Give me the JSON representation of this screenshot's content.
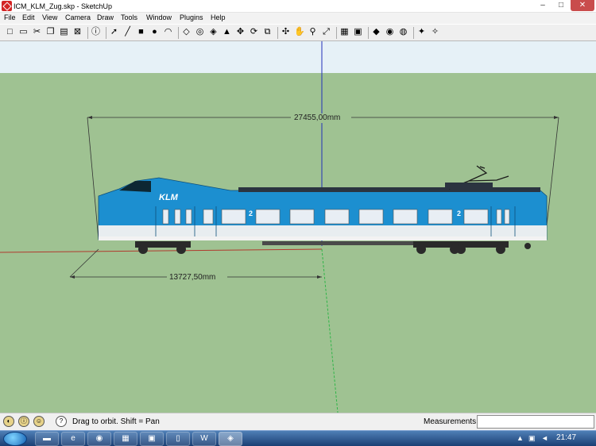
{
  "window": {
    "title": "ICM_KLM_Zug.skp - SketchUp",
    "minimize_glyph": "–",
    "maximize_glyph": "□",
    "close_glyph": "✕"
  },
  "menu": [
    "File",
    "Edit",
    "View",
    "Camera",
    "Draw",
    "Tools",
    "Window",
    "Plugins",
    "Help"
  ],
  "toolbar": {
    "tools": [
      {
        "name": "new-icon",
        "glyph": "□"
      },
      {
        "name": "open-icon",
        "glyph": "▭"
      },
      {
        "name": "cut-icon",
        "glyph": "✂"
      },
      {
        "name": "copy-icon",
        "glyph": "❐"
      },
      {
        "name": "paste-icon",
        "glyph": "▤"
      },
      {
        "name": "erase-icon",
        "glyph": "⊠"
      },
      {
        "name": "model-info-icon",
        "glyph": "ⓘ"
      },
      {
        "name": "select-icon",
        "glyph": "➚"
      },
      {
        "name": "line-icon",
        "glyph": "╱"
      },
      {
        "name": "rectangle-icon",
        "glyph": "■"
      },
      {
        "name": "circle-icon",
        "glyph": "●"
      },
      {
        "name": "arc-icon",
        "glyph": "◠"
      },
      {
        "name": "eraser-icon",
        "glyph": "◇"
      },
      {
        "name": "tape-measure-icon",
        "glyph": "◎"
      },
      {
        "name": "paint-bucket-icon",
        "glyph": "◈"
      },
      {
        "name": "push-pull-icon",
        "glyph": "▲"
      },
      {
        "name": "move-icon",
        "glyph": "✥"
      },
      {
        "name": "rotate-icon",
        "glyph": "⟳"
      },
      {
        "name": "offset-icon",
        "glyph": "⧉"
      },
      {
        "name": "orbit-icon",
        "glyph": "✣"
      },
      {
        "name": "pan-icon",
        "glyph": "✋"
      },
      {
        "name": "zoom-icon",
        "glyph": "⚲"
      },
      {
        "name": "zoom-extents-icon",
        "glyph": "⤢"
      },
      {
        "name": "warehouse-icon",
        "glyph": "▦"
      },
      {
        "name": "share-model-icon",
        "glyph": "▣"
      },
      {
        "name": "components-icon",
        "glyph": "◆"
      },
      {
        "name": "styles-icon",
        "glyph": "◉"
      },
      {
        "name": "earth-icon",
        "glyph": "◍"
      },
      {
        "name": "extension-icon",
        "glyph": "✦"
      },
      {
        "name": "extension-manager-icon",
        "glyph": "✧"
      }
    ]
  },
  "viewport": {
    "sky_color": "#e6f1f7",
    "ground_color": "#9fc292",
    "dimensions": {
      "length_total": "27455,00mm",
      "length_half": "13727,50mm"
    },
    "train": {
      "body_color": "#1c8fd0",
      "stripe_color": "#e8edf0",
      "logo_text": "KLM",
      "class_marker": "2"
    }
  },
  "statusbar": {
    "hint": "Drag to orbit.  Shift = Pan",
    "measurements_label": "Measurements",
    "measurements_value": ""
  },
  "taskbar": {
    "apps": [
      "folder-icon",
      "ie-icon",
      "chrome-icon",
      "app-icon",
      "app2-icon",
      "app3-icon",
      "word-icon",
      "sketchup-icon"
    ],
    "clock": "21:47"
  }
}
